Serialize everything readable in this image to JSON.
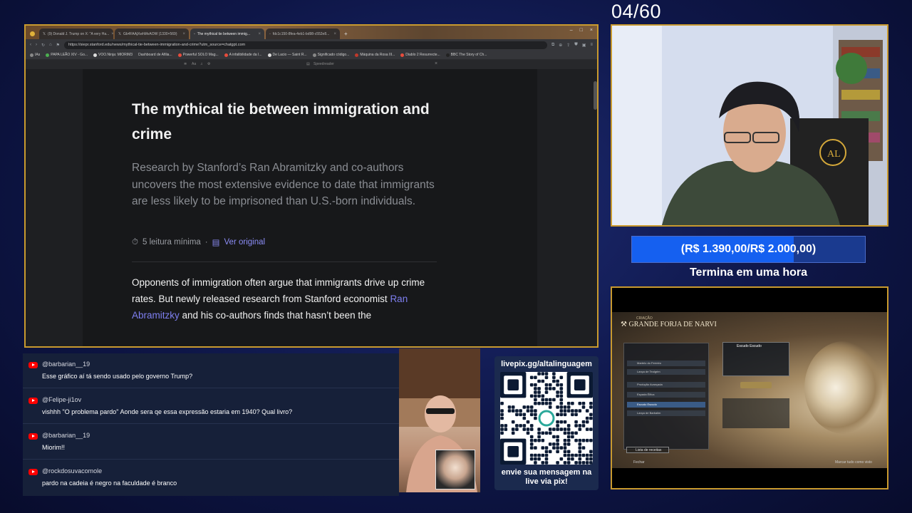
{
  "stream": {
    "counter": "04/60",
    "goal": {
      "text": "(R$ 1.390,00/R$ 2.000,00)",
      "progress_fraction": 0.695,
      "caption": "Termina em uma hora"
    }
  },
  "browser": {
    "tabs": [
      {
        "label": "(9) Donald J. Trump on X: \"A very Ha...",
        "icon": "x-logo-icon"
      },
      {
        "label": "Gb4FAAjXwhMvAOW (1330×569)",
        "icon": "x-logo-icon"
      },
      {
        "label": "The mythical tie between immig...",
        "icon": "page-icon",
        "active": true
      },
      {
        "label": "fdc1c150-8fea-4eb1-bd98-c552e8...",
        "icon": "page-icon"
      }
    ],
    "url": "https://siepr.stanford.edu/news/mythical-tie-between-immigration-and-crime?utm_source=chatgpt.com",
    "bookmarks": [
      "IAs",
      "PAPA LEÃO XIV - Go...",
      "VOO.Ninja: MIORIM3",
      "Dashboard de Afilia...",
      "Powerful SOLO Mag...",
      "A infalibilidade da I...",
      "De Lacio — Saint R...",
      "Significado código...",
      "Máquina da Rosa III...",
      "Diablo 2 Resurrecte...",
      "BBC The Story of Ch..."
    ],
    "reader_label": "Speedreader",
    "article": {
      "title": "The mythical tie between immigration and crime",
      "subtitle": "Research by Stanford’s Ran Abramitzky and co-authors uncovers the most extensive evidence to date that im­migrants are less likely to be imprisoned than U.S.-born individuals.",
      "read_time": "5 leitura mínima",
      "separator": "·",
      "view_original": "Ver original",
      "body_line1": "Opponents of immigration often argue that immigrants drive up crime rates. But newly released research from Stanford economist",
      "body_link": "Ran Abramitzky",
      "body_line2": " and his co-authors finds that hasn’t been the"
    }
  },
  "chat": [
    {
      "user": "@barbarian__19",
      "message": "Esse gráfico aí tá sendo usado pelo governo Trump?"
    },
    {
      "user": "@Felipe-ji1ov",
      "message": "vishhh \"O problema pardo\" Aonde sera qe essa expressão estaria em 1940? Qual livro?"
    },
    {
      "user": "@barbarian__19",
      "message": "Miorim!!"
    },
    {
      "user": "@rockdosuvacomole",
      "message": "pardo na cadeia é negro na faculdade é branco"
    }
  ],
  "donation": {
    "url": "livepix.gg/altalinguagem",
    "caption": "envie sua mensagem na live via pix!"
  },
  "game": {
    "subheader": "CRIAÇÃO",
    "title": "GRANDE FORJA DE NARVI",
    "menu_items": [
      "Martelo do Ferreiro",
      "Lança de Teolgrim",
      "Produção Avançada",
      "Espada Élfica",
      "Escudo Escudo",
      "Lança de Barbalim"
    ],
    "selected_item": "Escudo Escudo",
    "detail_title": "Escudo Escudo",
    "recipe_button": "Lista de receitas",
    "footer_left": "Fechar",
    "footer_right": "Marcar tudo como visto"
  },
  "colors": {
    "frame_gold": "#c99a2e",
    "goal_fill": "#1560f0",
    "link": "#7e7ff0",
    "youtube_red": "#ff0000"
  }
}
